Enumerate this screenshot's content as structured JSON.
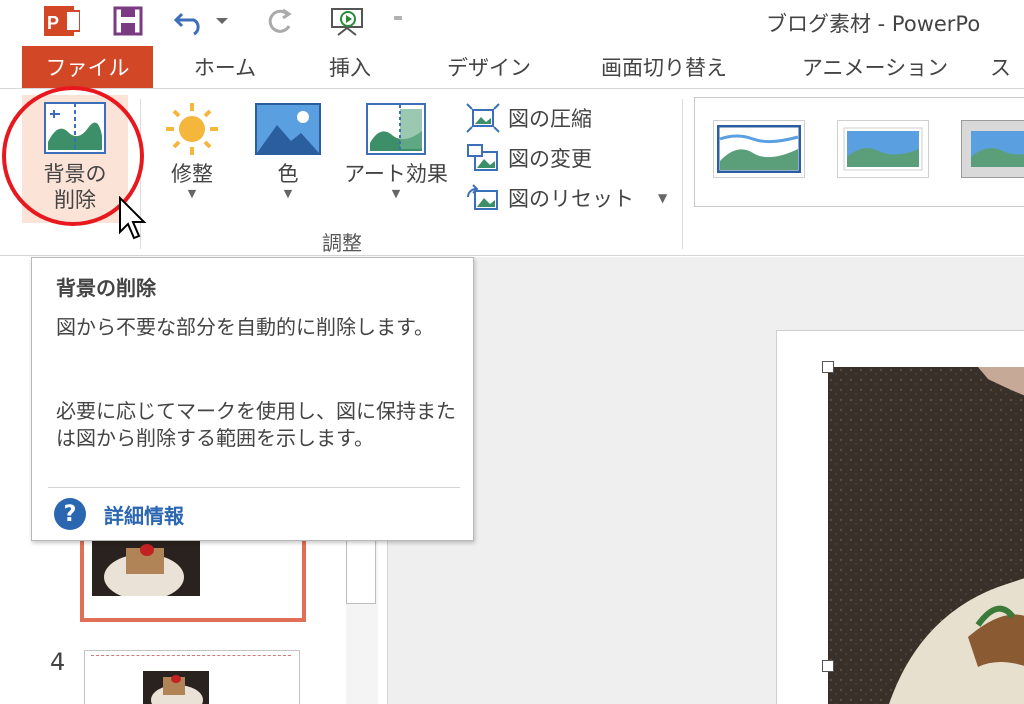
{
  "app": {
    "title": "ブログ素材 - PowerPo",
    "brand_color": "#d24726"
  },
  "quick_access": {
    "logo_icon": "powerpoint-logo-icon",
    "save_icon": "save-icon",
    "undo_icon": "undo-icon",
    "redo_icon": "redo-icon",
    "slideshow_icon": "from-beginning-icon",
    "customize_icon": "customize-qat-icon"
  },
  "tabs": [
    {
      "label": "ファイル"
    },
    {
      "label": "ホーム"
    },
    {
      "label": "挿入"
    },
    {
      "label": "デザイン"
    },
    {
      "label": "画面切り替え"
    },
    {
      "label": "アニメーション"
    },
    {
      "label": "ス"
    }
  ],
  "ribbon": {
    "adjust_group_label": "調整",
    "remove_background": {
      "line1": "背景の",
      "line2": "削除",
      "icon": "remove-background-icon"
    },
    "corrections": {
      "label": "修整",
      "icon": "sun-icon"
    },
    "color": {
      "label": "色",
      "icon": "color-picture-icon"
    },
    "artistic_effects": {
      "label": "アート効果",
      "icon": "artistic-effects-icon"
    },
    "compress": {
      "label": "図の圧縮",
      "icon": "compress-pictures-icon"
    },
    "change_picture": {
      "label": "図の変更",
      "icon": "change-picture-icon"
    },
    "reset_picture": {
      "label": "図のリセット",
      "icon": "reset-picture-icon"
    },
    "highlight_color": "#e8191e"
  },
  "tooltip": {
    "title": "背景の削除",
    "description": "図から不要な部分を自動的に削除します。",
    "description2": "必要に応じてマークを使用し、図に保持または図から削除する範囲を示します。",
    "help_label": "詳細情報",
    "help_icon": "help-icon",
    "help_color": "#2b66b1"
  },
  "slides_pane": {
    "slide_number": "4"
  }
}
